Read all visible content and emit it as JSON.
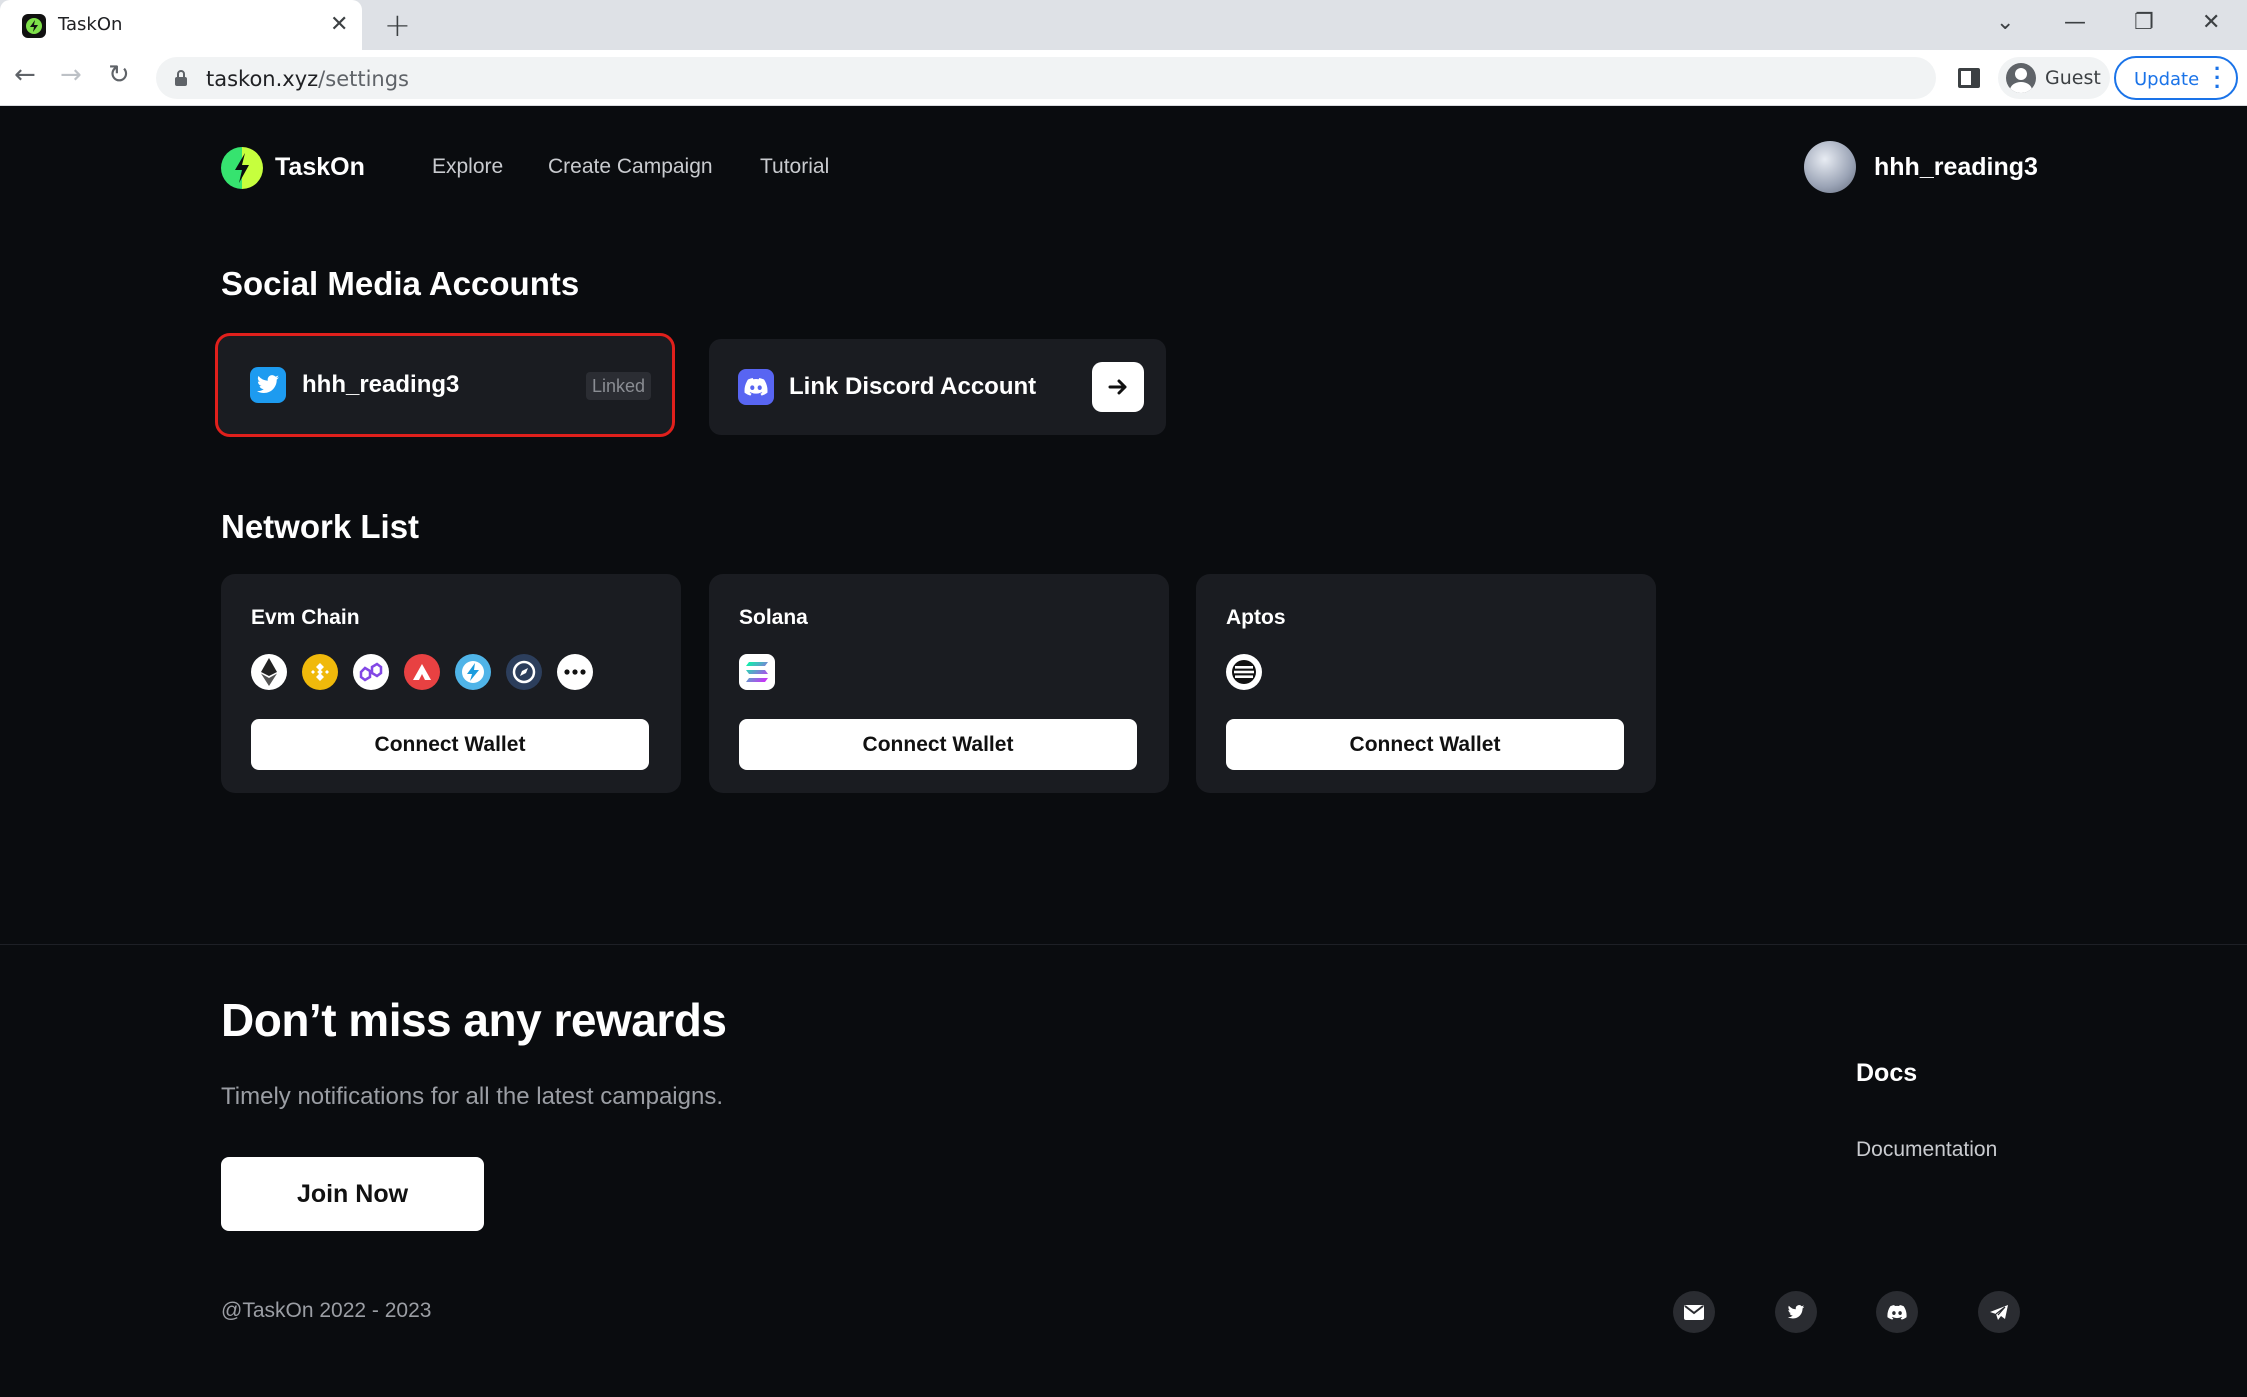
{
  "browser": {
    "tab_title": "TaskOn",
    "url_host": "taskon.xyz",
    "url_path": "/settings",
    "profile_name": "Guest",
    "update_label": "Update"
  },
  "header": {
    "brand": "TaskOn",
    "nav": [
      "Explore",
      "Create Campaign",
      "Tutorial"
    ],
    "username": "hhh_reading3"
  },
  "social": {
    "title": "Social Media Accounts",
    "twitter_handle": "hhh_reading3",
    "twitter_status": "Linked",
    "discord_label": "Link Discord Account"
  },
  "networks": {
    "title": "Network List",
    "items": [
      {
        "name": "Evm Chain",
        "button": "Connect Wallet",
        "chains": [
          "ethereum-icon",
          "bnb-icon",
          "polygon-icon",
          "avalanche-icon",
          "lightning-chain-icon",
          "compass-chain-icon",
          "more-icon"
        ]
      },
      {
        "name": "Solana",
        "button": "Connect Wallet",
        "chains": [
          "solana-icon"
        ]
      },
      {
        "name": "Aptos",
        "button": "Connect Wallet",
        "chains": [
          "aptos-icon"
        ]
      }
    ]
  },
  "footer": {
    "title": "Don’t miss any rewards",
    "subtitle": "Timely notifications for all the latest campaigns.",
    "join_label": "Join Now",
    "docs_title": "Docs",
    "docs_link": "Documentation",
    "copyright": "@TaskOn 2022 - 2023",
    "social_icons": [
      "email-icon",
      "twitter-icon",
      "discord-icon",
      "telegram-icon"
    ]
  },
  "colors": {
    "page_bg": "#0a0c0f",
    "card_bg": "#1a1c21",
    "highlight_border": "#e0201c",
    "twitter_blue": "#1d9bf0",
    "discord_purple": "#5865f2"
  }
}
